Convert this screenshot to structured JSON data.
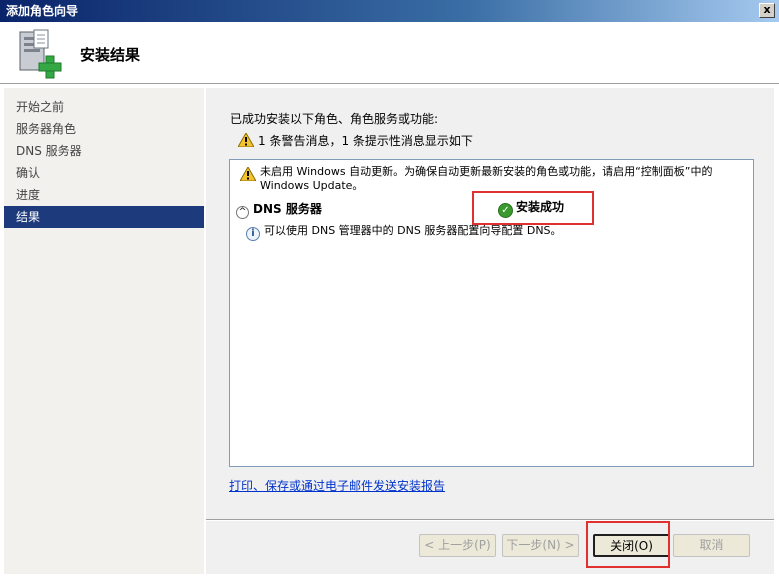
{
  "window": {
    "title": "添加角色向导",
    "close_glyph": "x"
  },
  "header": {
    "title": "安装结果",
    "icon": "server-add-icon"
  },
  "nav": {
    "items": [
      {
        "label": "开始之前"
      },
      {
        "label": "服务器角色"
      },
      {
        "label": "DNS 服务器"
      },
      {
        "label": "确认"
      },
      {
        "label": "进度"
      },
      {
        "label": "结果"
      }
    ],
    "active_index": 5
  },
  "main": {
    "intro": "已成功安装以下角色、角色服务或功能:",
    "summary": "1 条警告消息，1 条提示性消息显示如下",
    "warning_message": "未启用 Windows 自动更新。为确保自动更新最新安装的角色或功能，请启用“控制面板”中的 Windows Update。",
    "result": {
      "role": "DNS 服务器",
      "collapse_glyph": "^",
      "status": "安装成功",
      "status_glyph": "✓",
      "info_glyph": "i",
      "info": "可以使用 DNS 管理器中的 DNS 服务器配置向导配置 DNS。"
    },
    "report_link": "打印、保存或通过电子邮件发送安装报告"
  },
  "buttons": {
    "prev": "< 上一步(P)",
    "next": "下一步(N) >",
    "close": "关闭(O)",
    "cancel": "取消"
  },
  "colors": {
    "highlight": "#e03030",
    "nav_active": "#1c3a7c",
    "success": "#3a9a2e",
    "link": "#0033cc"
  }
}
